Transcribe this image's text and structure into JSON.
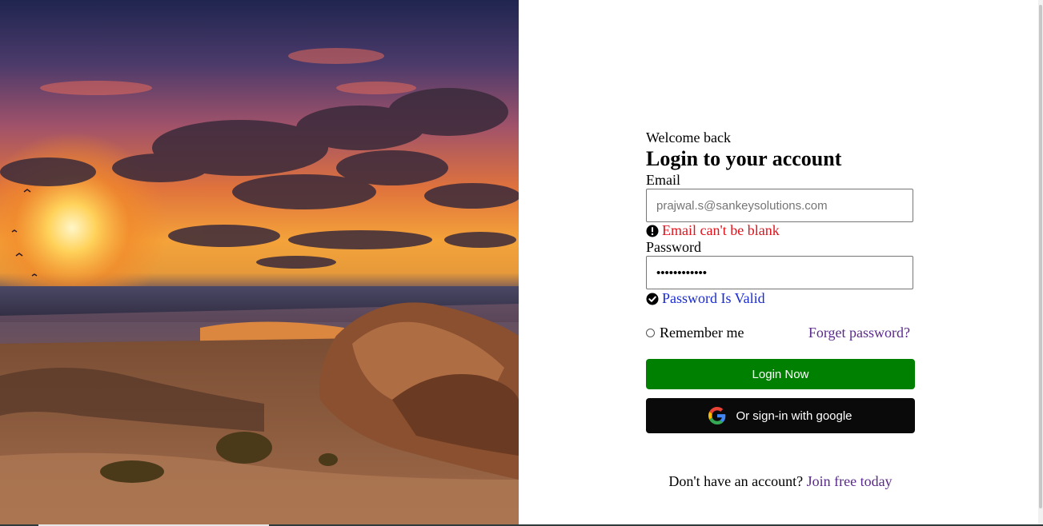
{
  "hero": {
    "icon": "sunset-beach-image"
  },
  "form": {
    "welcome": "Welcome back",
    "title": "Login to your account",
    "email": {
      "label": "Email",
      "placeholder": "prajwal.s@sankeysolutions.com",
      "value": ""
    },
    "email_error": "Email can't be blank",
    "password": {
      "label": "Password",
      "masked_value": "••••••••••••"
    },
    "password_status": "Password Is Valid",
    "remember_label": "Remember me",
    "forgot_label": "Forget password?",
    "login_label": "Login Now",
    "google_label": "Or sign-in with google",
    "signup_prompt": "Don't have an account?",
    "signup_link": "Join free today"
  },
  "colors": {
    "login_button": "#008000",
    "google_button": "#0a0a0a",
    "error": "#e3111b",
    "success": "#1a2bd4",
    "link": "#5a2a8a"
  }
}
